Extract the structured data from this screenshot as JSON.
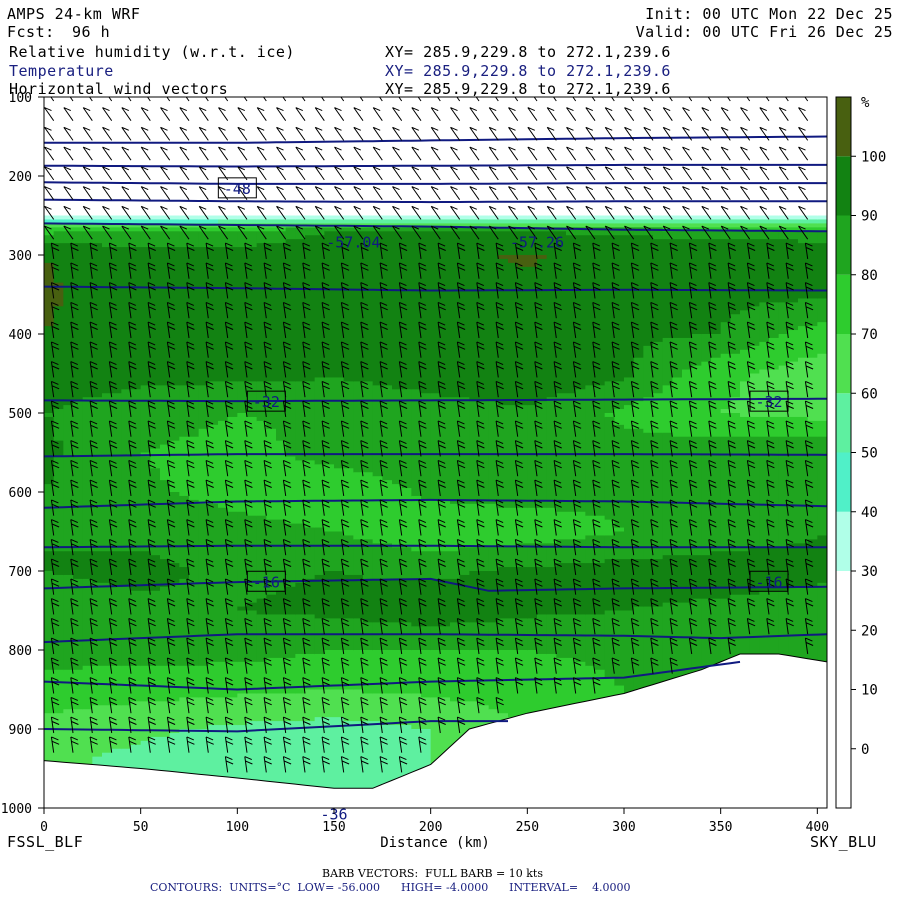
{
  "header": {
    "model": "AMPS 24-km WRF",
    "fcst_label": "Fcst:",
    "fcst_value": "96 h",
    "init": "Init: 00 UTC Mon 22 Dec 25",
    "valid": "Valid: 00 UTC Fri 26 Dec 25",
    "fields": [
      {
        "name": "Relative humidity (w.r.t. ice)",
        "xy": "XY= 285.9,229.8 to 272.1,239.6"
      },
      {
        "name": "Temperature",
        "xy": "XY= 285.9,229.8 to 272.1,239.6"
      },
      {
        "name": "Horizontal wind vectors",
        "xy": "XY= 285.9,229.8 to 272.1,239.6"
      }
    ]
  },
  "footer": {
    "left_label": "FSSL_BLF",
    "right_label": "SKY_BLU",
    "barb_note": "BARB VECTORS:  FULL BARB = 10 kts",
    "contour_note": "CONTOURS:  UNITS=°C  LOW= -56.000      HIGH= -4.0000      INTERVAL=    4.0000"
  },
  "colors": {
    "rh_bins": [
      "#ffffff",
      "#ffffff",
      "#ffffff",
      "#ffffff",
      "#b0ffe8",
      "#50f0c8",
      "#5ef0a0",
      "#50e050",
      "#2ecc2e",
      "#1fa51f",
      "#128212",
      "#486010"
    ],
    "contour": "#101a80",
    "barb": "#000000",
    "terrain": "#ffffff"
  },
  "chart_data": {
    "type": "heatmap",
    "xlabel": "Distance (km)",
    "x_ticks": [
      0,
      50,
      100,
      150,
      200,
      250,
      300,
      350,
      400
    ],
    "xlim": [
      0,
      405
    ],
    "y_ticks": [
      100,
      200,
      300,
      400,
      500,
      600,
      700,
      800,
      900,
      1000
    ],
    "ylim": [
      100,
      1000
    ],
    "colorbar": {
      "unit": "%",
      "ticks": [
        0,
        10,
        20,
        30,
        40,
        50,
        60,
        70,
        80,
        90,
        100
      ],
      "range": [
        -10,
        110
      ]
    },
    "rh_field": {
      "x_km": [
        0,
        50,
        100,
        150,
        200,
        250,
        300,
        350,
        405
      ],
      "p_hpa": [
        100,
        200,
        250,
        270,
        300,
        350,
        400,
        450,
        500,
        550,
        600,
        650,
        700,
        750,
        800,
        850,
        900,
        950,
        1000
      ],
      "values": [
        [
          5,
          5,
          5,
          5,
          5,
          5,
          5,
          5,
          5
        ],
        [
          8,
          8,
          8,
          8,
          8,
          8,
          8,
          8,
          8
        ],
        [
          30,
          30,
          30,
          30,
          30,
          30,
          30,
          30,
          30
        ],
        [
          78,
          80,
          84,
          90,
          92,
          90,
          88,
          86,
          84
        ],
        [
          100,
          96,
          93,
          95,
          98,
          101,
          97,
          99,
          97
        ],
        [
          101,
          96,
          92,
          92,
          100,
          98,
          94,
          92,
          92
        ],
        [
          100,
          95,
          91,
          90,
          99,
          92,
          92,
          90,
          74
        ],
        [
          94,
          92,
          93,
          91,
          94,
          99,
          92,
          72,
          64
        ],
        [
          90,
          86,
          80,
          82,
          86,
          88,
          78,
          70,
          66
        ],
        [
          92,
          80,
          76,
          84,
          88,
          86,
          84,
          86,
          88
        ],
        [
          90,
          82,
          76,
          72,
          82,
          84,
          82,
          88,
          90
        ],
        [
          90,
          88,
          84,
          80,
          72,
          74,
          80,
          86,
          90
        ],
        [
          90,
          92,
          88,
          90,
          88,
          92,
          94,
          94,
          92
        ],
        [
          86,
          88,
          90,
          92,
          96,
          92,
          90,
          88,
          86
        ],
        [
          84,
          84,
          84,
          80,
          80,
          80,
          82,
          80,
          80
        ],
        [
          76,
          74,
          72,
          70,
          72,
          74,
          80,
          80,
          80
        ],
        [
          66,
          62,
          58,
          56,
          60,
          70,
          80,
          80,
          80
        ],
        [
          62,
          56,
          50,
          50,
          60,
          70,
          80,
          80,
          80
        ],
        [
          60,
          55,
          50,
          50,
          60,
          70,
          80,
          80,
          80
        ]
      ]
    },
    "terrain_surface": {
      "x_km": [
        0,
        50,
        100,
        150,
        170,
        200,
        220,
        250,
        300,
        340,
        360,
        380,
        405
      ],
      "p_hpa": [
        940,
        950,
        962,
        975,
        975,
        945,
        900,
        880,
        855,
        825,
        805,
        805,
        815
      ]
    },
    "temperature_contours": [
      {
        "level": -40,
        "x_km": [
          0,
          100,
          200,
          300,
          405
        ],
        "p_hpa": [
          230,
          232,
          233,
          232,
          232
        ]
      },
      {
        "level": -44,
        "x_km": [
          0,
          100,
          200,
          300,
          405
        ],
        "p_hpa": [
          208,
          210,
          210,
          209,
          209
        ]
      },
      {
        "level": -48,
        "x_km": [
          0,
          100,
          200,
          300,
          405
        ],
        "p_hpa": [
          187,
          188,
          187,
          186,
          186
        ]
      },
      {
        "level": -52,
        "x_km": [
          0,
          100,
          200,
          300,
          405
        ],
        "p_hpa": [
          158,
          158,
          155,
          152,
          150
        ]
      },
      {
        "level": -56,
        "x_km": [
          0,
          100,
          200,
          300,
          405
        ],
        "p_hpa": [
          260,
          262,
          264,
          268,
          270
        ]
      },
      {
        "level": -36,
        "x_km": [
          0,
          100,
          200,
          300,
          405
        ],
        "p_hpa": [
          340,
          342,
          345,
          344,
          345
        ]
      },
      {
        "level": -32,
        "x_km": [
          0,
          100,
          200,
          300,
          405
        ],
        "p_hpa": [
          484,
          485,
          484,
          483,
          482
        ]
      },
      {
        "level": -28,
        "x_km": [
          0,
          100,
          200,
          300,
          405
        ],
        "p_hpa": [
          555,
          552,
          552,
          552,
          553
        ]
      },
      {
        "level": -24,
        "x_km": [
          0,
          100,
          200,
          300,
          405
        ],
        "p_hpa": [
          620,
          612,
          610,
          612,
          618
        ]
      },
      {
        "level": -20,
        "x_km": [
          0,
          100,
          200,
          300,
          405
        ],
        "p_hpa": [
          670,
          668,
          668,
          670,
          670
        ]
      },
      {
        "level": -16,
        "x_km": [
          0,
          100,
          200,
          230,
          300,
          405
        ],
        "p_hpa": [
          722,
          714,
          710,
          725,
          722,
          720
        ]
      },
      {
        "level": -12,
        "x_km": [
          0,
          100,
          200,
          300,
          350,
          405
        ],
        "p_hpa": [
          790,
          780,
          780,
          782,
          785,
          780
        ]
      },
      {
        "level": -8,
        "x_km": [
          0,
          100,
          200,
          300,
          360
        ],
        "p_hpa": [
          840,
          850,
          840,
          835,
          815
        ]
      },
      {
        "level": -4,
        "x_km": [
          0,
          100,
          200,
          240
        ],
        "p_hpa": [
          900,
          903,
          890,
          890
        ]
      }
    ],
    "contour_labels": [
      {
        "text": "-48",
        "x_km": 100,
        "p_hpa": 215,
        "boxed": true
      },
      {
        "text": "-57.04",
        "x_km": 160,
        "p_hpa": 283,
        "boxed": false
      },
      {
        "text": "-57.26",
        "x_km": 255,
        "p_hpa": 283,
        "boxed": false
      },
      {
        "text": "-32",
        "x_km": 115,
        "p_hpa": 485,
        "boxed": true
      },
      {
        "text": "-32",
        "x_km": 375,
        "p_hpa": 485,
        "boxed": true
      },
      {
        "text": "-16",
        "x_km": 115,
        "p_hpa": 713,
        "boxed": true
      },
      {
        "text": "-16",
        "x_km": 375,
        "p_hpa": 713,
        "boxed": true
      },
      {
        "text": "-36",
        "x_km": 150,
        "p_hpa": 1007,
        "boxed": false
      }
    ]
  }
}
